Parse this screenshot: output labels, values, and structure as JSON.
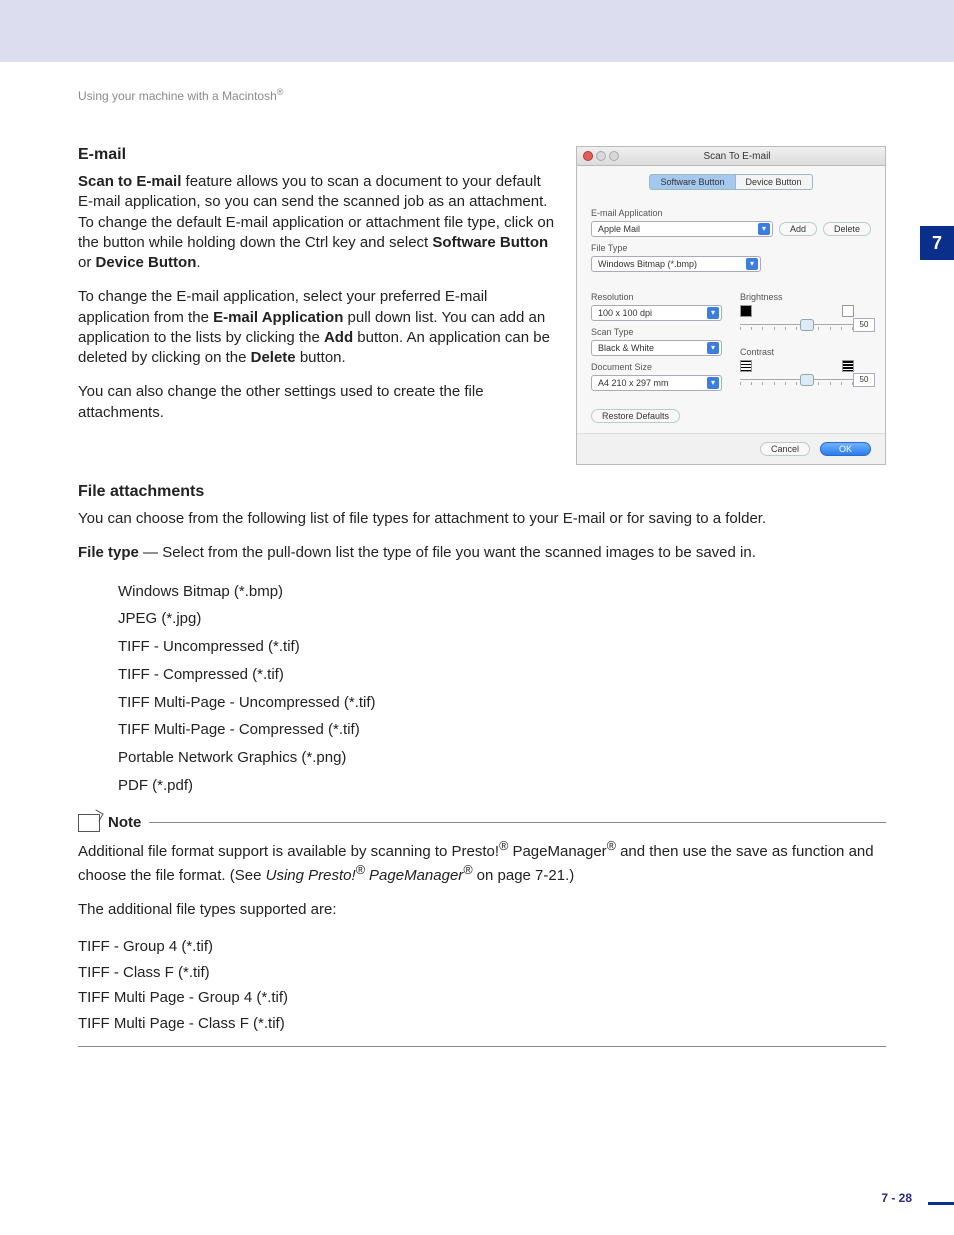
{
  "header": {
    "breadcrumb": "Using your machine with a Macintosh",
    "reg": "®"
  },
  "sidetab": "7",
  "email": {
    "heading": "E-mail",
    "p1_bold": "Scan to E-mail",
    "p1_rest": " feature allows you to scan a document to your default E-mail application, so you can send the scanned job as an attachment. To change the default E-mail application or attachment file type, click on the button while holding down the Ctrl key and select ",
    "p1_b2": "Software Button",
    "p1_mid": " or ",
    "p1_b3": "Device Button",
    "p1_end": ".",
    "p2a": "To change the E-mail application, select your preferred E-mail application from the ",
    "p2b": "E-mail Application",
    "p2c": " pull down list. You can add an application to the lists by clicking the ",
    "p2d": "Add",
    "p2e": " button. An application can be deleted by clicking on the ",
    "p2f": "Delete",
    "p2g": " button.",
    "p3": "You can also change the other settings used to create the file attachments."
  },
  "dialog": {
    "title": "Scan To E-mail",
    "tab1": "Software Button",
    "tab2": "Device Button",
    "lbl_app": "E-mail Application",
    "app_val": "Apple Mail",
    "btn_add": "Add",
    "btn_del": "Delete",
    "lbl_ft": "File Type",
    "ft_val": "Windows Bitmap (*.bmp)",
    "lbl_res": "Resolution",
    "res_val": "100 x 100 dpi",
    "lbl_st": "Scan Type",
    "st_val": "Black & White",
    "lbl_ds": "Document Size",
    "ds_val": "A4 210 x 297 mm",
    "lbl_br": "Brightness",
    "lbl_ct": "Contrast",
    "val50": "50",
    "btn_restore": "Restore Defaults",
    "btn_cancel": "Cancel",
    "btn_ok": "OK"
  },
  "fa": {
    "heading": "File attachments",
    "p1": "You can choose from the following list of file types for attachment to your E-mail or for saving to a folder.",
    "p2a": "File type",
    "p2b": " — Select from the pull-down list the type of file you want the scanned images to be saved in.",
    "items": {
      "0": "Windows Bitmap (*.bmp)",
      "1": "JPEG (*.jpg)",
      "2": "TIFF - Uncompressed (*.tif)",
      "3": "TIFF - Compressed (*.tif)",
      "4": "TIFF Multi-Page - Uncompressed (*.tif)",
      "5": "TIFF Multi-Page - Compressed (*.tif)",
      "6": "Portable Network Graphics (*.png)",
      "7": "PDF (*.pdf)"
    }
  },
  "note": {
    "label": "Note",
    "p1a": "Additional file format support is available by scanning to Presto!",
    "p1b": " PageManager",
    "p1c": " and then use the save as function and choose the file format. (See ",
    "p1d": "Using Presto!",
    "p1e": " PageManager",
    "p1f": " on page 7-21.)",
    "p2": "The additional file types supported are:",
    "items": {
      "0": "TIFF - Group 4 (*.tif)",
      "1": "TIFF - Class F (*.tif)",
      "2": "TIFF Multi Page - Group 4 (*.tif)",
      "3": "TIFF Multi Page - Class F (*.tif)"
    }
  },
  "footer": {
    "page": "7 - 28"
  }
}
